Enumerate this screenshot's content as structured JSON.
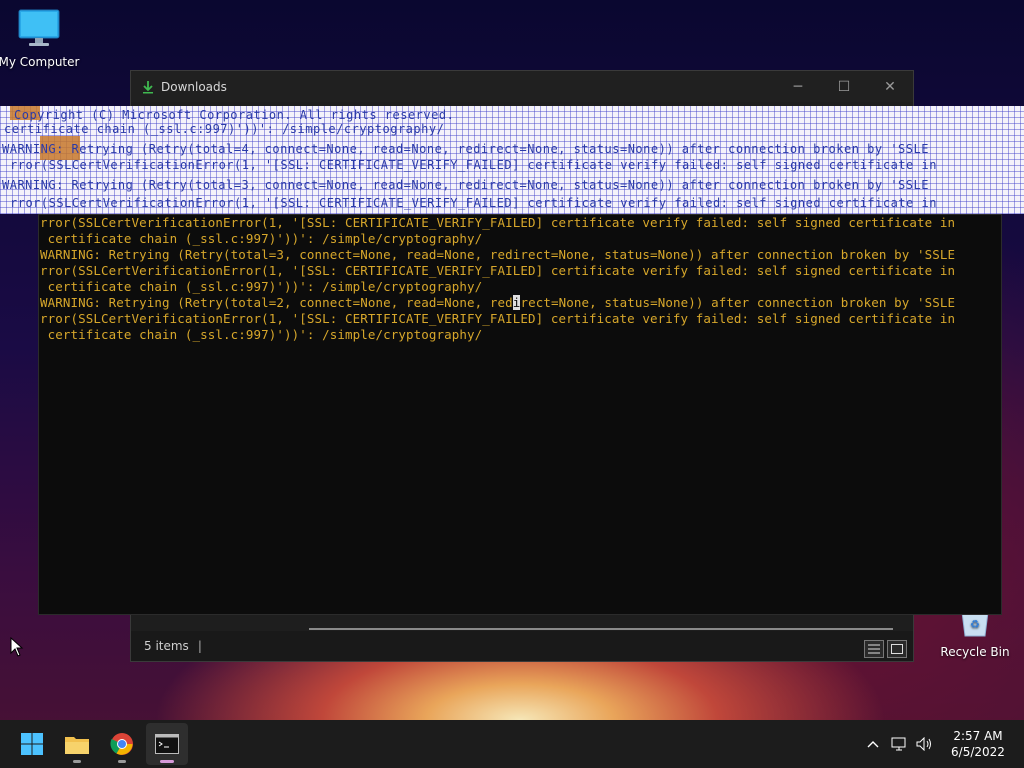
{
  "desktop": {
    "my_computer_label": "My Computer",
    "recycle_bin_label": "Recycle Bin"
  },
  "explorer": {
    "title": "Downloads",
    "status_items": "5 items",
    "status_sep": "|"
  },
  "glitch_text": [
    "Copyright (C) Microsoft Corporation. All rights reserved.",
    "certificate chain (_ssl.c:997)'))': /simple/cryptography/",
    "WARNING: Retrying (Retry(total=4, connect=None, read=None, redirect=None, status=None)) after connection broken by 'SSLE",
    "rror(SSLCertVerificationError(1, '[SSL: CERTIFICATE_VERIFY_FAILED] certificate verify failed: self signed certificate in",
    "WARNING: Retrying (Retry(total=3, connect=None, read=None, redirect=None, status=None)) after connection broken by 'SSLE",
    "rror(SSLCertVerificationError(1, '[SSL: CERTIFICATE_VERIFY_FAILED] certificate verify failed: self signed certificate in"
  ],
  "terminal": {
    "lines": [
      "rror(SSLCertVerificationError(1, '[SSL: CERTIFICATE_VERIFY_FAILED] certificate verify failed: self signed certificate in",
      " certificate chain (_ssl.c:997)'))': /simple/cryptography/",
      "WARNING: Retrying (Retry(total=3, connect=None, read=None, redirect=None, status=None)) after connection broken by 'SSLE",
      "rror(SSLCertVerificationError(1, '[SSL: CERTIFICATE_VERIFY_FAILED] certificate verify failed: self signed certificate in",
      " certificate chain (_ssl.c:997)'))': /simple/cryptography/",
      "rror(SSLCertVerificationError(1, '[SSL: CERTIFICATE_VERIFY_FAILED] certificate verify failed: self signed certificate in",
      " certificate chain (_ssl.c:997)'))': /simple/cryptography/"
    ],
    "cursor_line_before": "WARNING: Retrying (Retry(total=2, connect=None, read=None, red",
    "cursor_char": "i",
    "cursor_line_after": "rect=None, status=None)) after connection broken by 'SSLE"
  },
  "taskbar": {
    "apps": [
      "start-icon",
      "file-explorer-icon",
      "chrome-icon",
      "terminal-icon"
    ],
    "time": "2:57 AM",
    "date": "6/5/2022"
  },
  "colors": {
    "terminal_text": "#d7a72b",
    "terminal_bg": "#0c0c0c",
    "taskbar_bg": "#1c1c1c"
  }
}
